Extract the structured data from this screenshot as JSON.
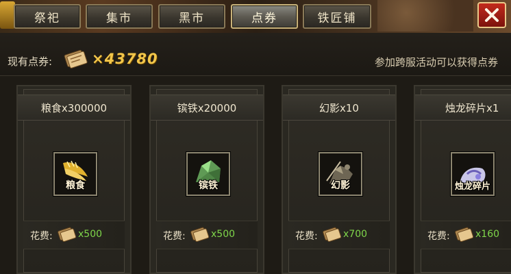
{
  "tabs": [
    {
      "label": "祭祀",
      "active": false
    },
    {
      "label": "集市",
      "active": false
    },
    {
      "label": "黑市",
      "active": false
    },
    {
      "label": "点券",
      "active": true
    },
    {
      "label": "铁匠铺",
      "active": false
    }
  ],
  "balance": {
    "label": "现有点券:",
    "value": "×43780"
  },
  "hint": "参加跨服活动可以获得点券",
  "items": [
    {
      "name": "粮食x300000",
      "icon_caption": "粮食",
      "icon": "grain-icon",
      "cost_label": "花费:",
      "cost": "x500"
    },
    {
      "name": "镔铁x20000",
      "icon_caption": "镔铁",
      "icon": "iron-ore-icon",
      "cost_label": "花费:",
      "cost": "x500"
    },
    {
      "name": "幻影x10",
      "icon_caption": "幻影",
      "icon": "phantom-icon",
      "cost_label": "花费:",
      "cost": "x700"
    },
    {
      "name": "烛龙碎片x1",
      "icon_caption": "烛龙碎片",
      "icon": "dragon-shard-icon",
      "cost_label": "花费:",
      "cost": "x160"
    }
  ],
  "colors": {
    "currency": "#f2c64a",
    "cost": "#7fd64a",
    "close": "#c22a1c"
  }
}
